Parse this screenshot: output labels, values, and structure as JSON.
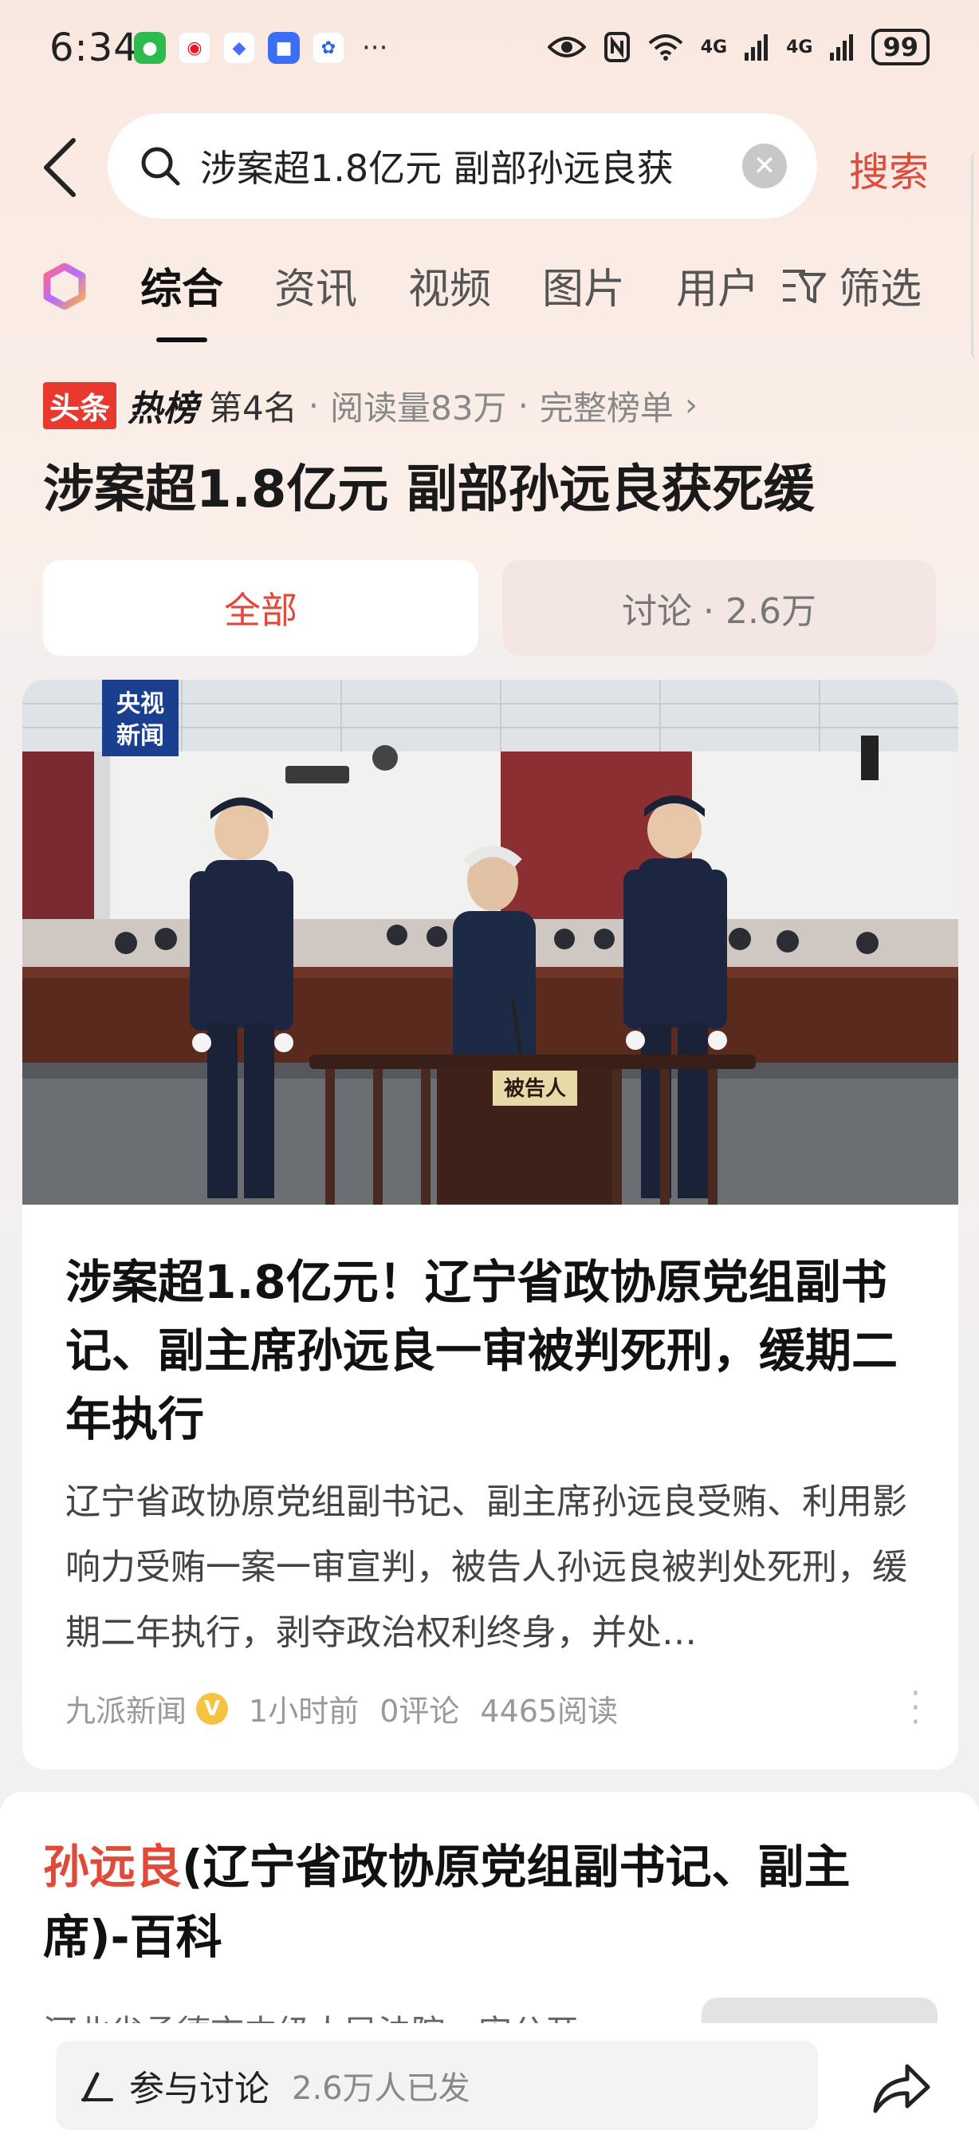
{
  "status_bar": {
    "time": "6:34",
    "dots": "···",
    "battery": "99",
    "network_1": "4G",
    "network_2": "4G"
  },
  "search": {
    "query": "涉案超1.8亿元 副部孙远良获",
    "button_label": "搜索"
  },
  "tabs": [
    {
      "label": "综合",
      "active": true
    },
    {
      "label": "资讯"
    },
    {
      "label": "视频"
    },
    {
      "label": "图片"
    },
    {
      "label": "用户"
    }
  ],
  "filter_label": "筛选",
  "hot": {
    "badge_head": "头条",
    "badge_hot": "热榜",
    "rank": "第4名",
    "sep": "·",
    "reads": "阅读量83万",
    "full_list": "完整榜单",
    "title": "涉案超1.8亿元 副部孙远良获死缓"
  },
  "segments": {
    "all": "全部",
    "discussion": "讨论 · 2.6万"
  },
  "card1": {
    "image": {
      "watermark_line1": "央视",
      "watermark_line2": "新闻",
      "stand_label": "被告人"
    },
    "title": "涉案超1.8亿元！辽宁省政协原党组副书记、副主席孙远良一审被判死刑，缓期二年执行",
    "description": "辽宁省政协原党组副书记、副主席孙远良受贿、利用影响力受贿一案一审宣判，被告人孙远良被判处死刑，缓期二年执行，剥夺政治权利终身，并处…",
    "source": "九派新闻",
    "verified": "V",
    "time": "1小时前",
    "comments": "0评论",
    "reads": "4465阅读"
  },
  "card2": {
    "title_highlight": "孙远良",
    "title_rest": "(辽宁省政协原党组副书记、副主席)-百科",
    "snippet": "河北省承德市中级人民法院一审公开"
  },
  "bottom": {
    "discuss_label": "参与讨论",
    "discuss_count": "2.6万人已发"
  },
  "colors": {
    "accent_red": "#e04a3a",
    "verified_yellow": "#f5c241"
  }
}
